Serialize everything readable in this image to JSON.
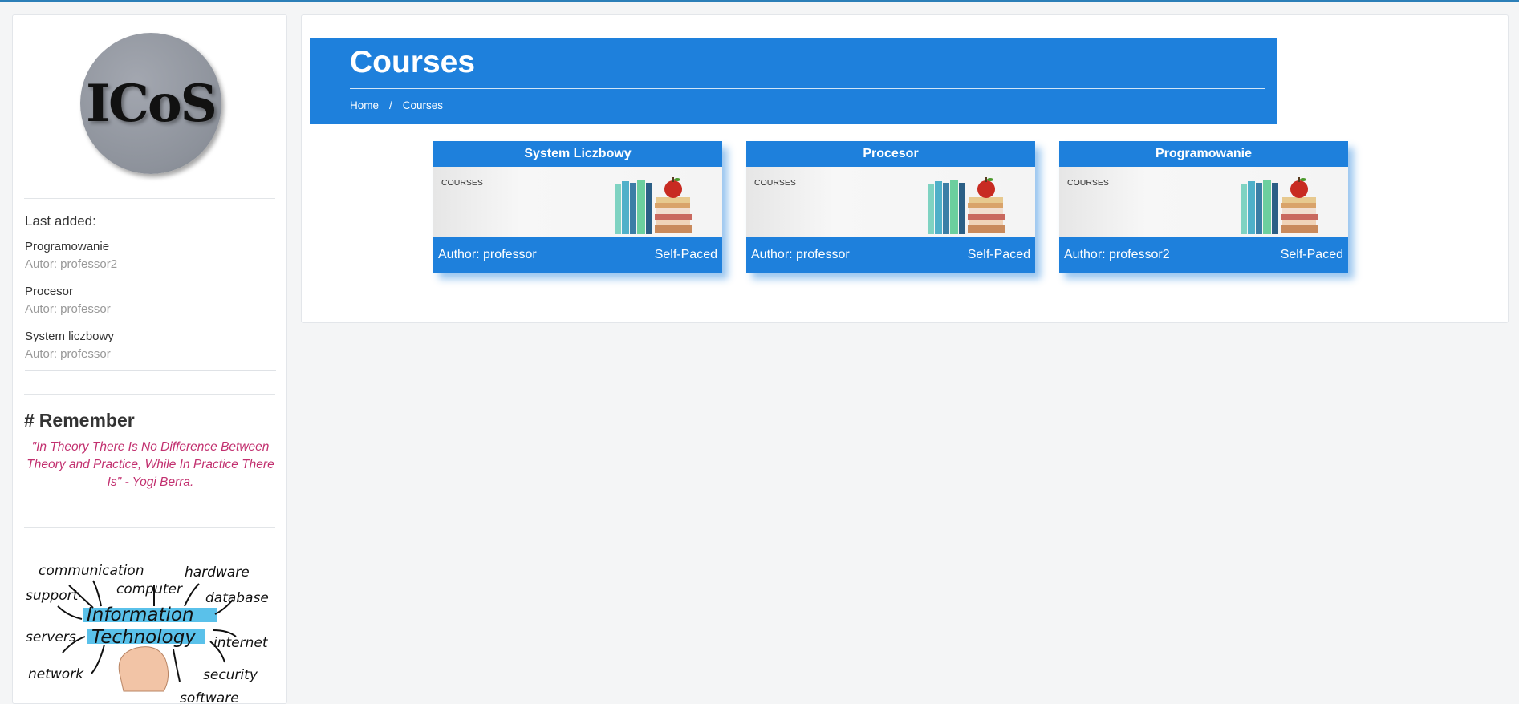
{
  "sidebar": {
    "logo_text": "ICoS",
    "last_added_title": "Last added:",
    "last_added": [
      {
        "name": "Programowanie",
        "author": "Autor: professor2"
      },
      {
        "name": "Procesor",
        "author": "Autor: professor"
      },
      {
        "name": "System liczbowy",
        "author": "Autor: professor"
      }
    ],
    "remember_hash": "#",
    "remember_title": "Remember",
    "quote": "\"In Theory There Is No Difference Between Theory and Practice, While In Practice There Is\" - Yogi Berra.",
    "it_words": [
      "communication",
      "hardware",
      "support",
      "computer",
      "database",
      "Information",
      "Technology",
      "servers",
      "internet",
      "network",
      "security",
      "software"
    ]
  },
  "banner": {
    "title": "Courses",
    "breadcrumb": [
      {
        "label": "Home"
      },
      {
        "label": "Courses"
      }
    ],
    "breadcrumb_sep": "/"
  },
  "courses": [
    {
      "title": "System Liczbowy",
      "image_label": "COURSES",
      "author": "Author: professor",
      "pace": "Self-Paced"
    },
    {
      "title": "Procesor",
      "image_label": "COURSES",
      "author": "Author: professor",
      "pace": "Self-Paced"
    },
    {
      "title": "Programowanie",
      "image_label": "COURSES",
      "author": "Author: professor2",
      "pace": "Self-Paced"
    }
  ],
  "colors": {
    "primary": "#1e80dc",
    "quote": "#c2306f",
    "page_bg": "#f4f5f6"
  }
}
